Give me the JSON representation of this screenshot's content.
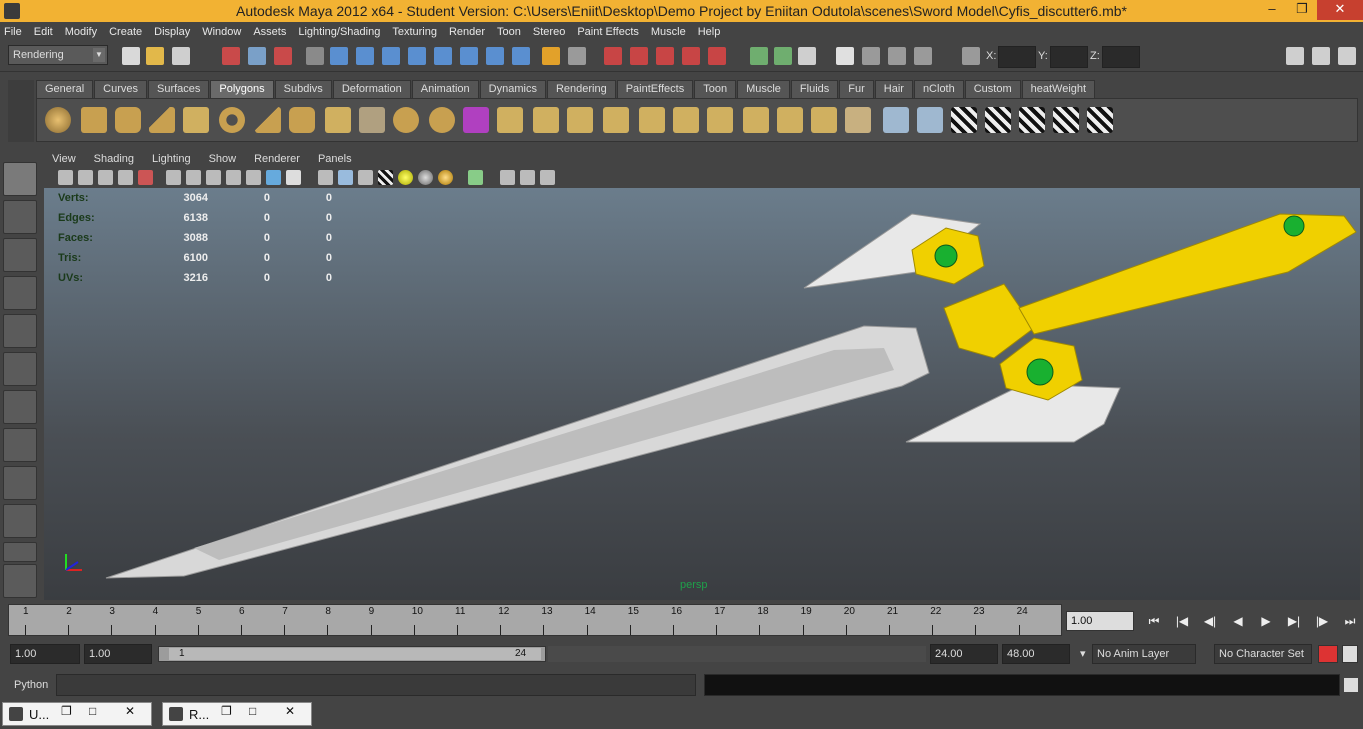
{
  "window": {
    "title": "Autodesk Maya 2012 x64 - Student Version: C:\\Users\\Eniit\\Desktop\\Demo Project by Eniitan Odutola\\scenes\\Sword Model\\Cyfis_discutter6.mb*",
    "minimize": "–",
    "restore": "❐",
    "close": "✕"
  },
  "menubar": [
    "File",
    "Edit",
    "Modify",
    "Create",
    "Display",
    "Window",
    "Assets",
    "Lighting/Shading",
    "Texturing",
    "Render",
    "Toon",
    "Stereo",
    "Paint Effects",
    "Muscle",
    "Help"
  ],
  "status": {
    "mode": "Rendering",
    "x_label": "X:",
    "y_label": "Y:",
    "z_label": "Z:"
  },
  "shelf_tabs": [
    "General",
    "Curves",
    "Surfaces",
    "Polygons",
    "Subdivs",
    "Deformation",
    "Animation",
    "Dynamics",
    "Rendering",
    "PaintEffects",
    "Toon",
    "Muscle",
    "Fluids",
    "Fur",
    "Hair",
    "nCloth",
    "Custom",
    "heatWeight"
  ],
  "panel_menu": [
    "View",
    "Shading",
    "Lighting",
    "Show",
    "Renderer",
    "Panels"
  ],
  "hud": [
    {
      "label": "Verts:",
      "a": "3064",
      "b": "0",
      "c": "0"
    },
    {
      "label": "Edges:",
      "a": "6138",
      "b": "0",
      "c": "0"
    },
    {
      "label": "Faces:",
      "a": "3088",
      "b": "0",
      "c": "0"
    },
    {
      "label": "Tris:",
      "a": "6100",
      "b": "0",
      "c": "0"
    },
    {
      "label": "UVs:",
      "a": "3216",
      "b": "0",
      "c": "0"
    }
  ],
  "viewport": {
    "camera": "persp"
  },
  "timeline": {
    "ticks": [
      "1",
      "2",
      "3",
      "4",
      "5",
      "6",
      "7",
      "8",
      "9",
      "10",
      "11",
      "12",
      "13",
      "14",
      "15",
      "16",
      "17",
      "18",
      "19",
      "20",
      "21",
      "22",
      "23",
      "24"
    ],
    "current_frame": "1.00"
  },
  "playback": [
    "⏮",
    "|◀",
    "◀|",
    "◀",
    "▶",
    "▶|",
    "|▶",
    "⏭"
  ],
  "range": {
    "start": "1.00",
    "playback_start": "1.00",
    "slider_start": "1",
    "slider_end": "24",
    "playback_end": "24.00",
    "end": "48.00"
  },
  "layers": {
    "anim_layer": "No Anim Layer",
    "character_set": "No Character Set"
  },
  "command": {
    "language": "Python"
  },
  "minimized": [
    {
      "label": "U...",
      "restore": "❐",
      "max": "□",
      "close": "✕"
    },
    {
      "label": "R...",
      "restore": "❐",
      "max": "□",
      "close": "✕"
    }
  ],
  "colors": {
    "title_bar": "#f2b233",
    "viewport_top": "#6b7d8c",
    "hud_green": "#1fa04a",
    "sword_gold": "#f0d000",
    "sword_blade": "#d8d8d8",
    "gem": "#19b030"
  }
}
